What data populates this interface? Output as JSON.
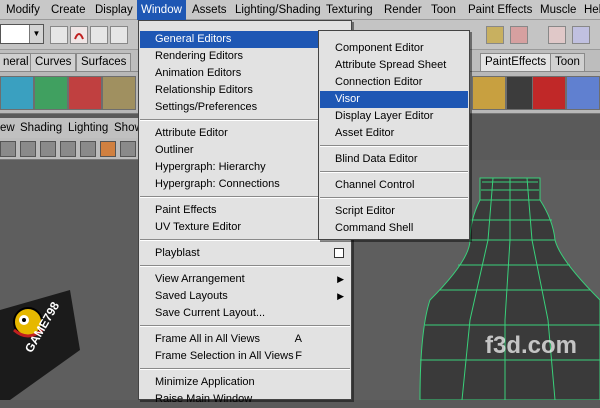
{
  "menubar": {
    "items": [
      "Modify",
      "Create",
      "Display",
      "Window",
      "Assets",
      "Lighting/Shading",
      "Texturing",
      "Render",
      "Toon",
      "Paint Effects",
      "Muscle",
      "Hel"
    ]
  },
  "shelf": {
    "tabs": [
      "neral",
      "Curves",
      "Surfaces",
      "PaintEffects",
      "Toon"
    ]
  },
  "panel": {
    "menus": [
      "ew",
      "Shading",
      "Lighting",
      "Show"
    ]
  },
  "window_menu": {
    "group1": [
      {
        "label": "General Editors",
        "submenu": true
      },
      {
        "label": "Rendering Editors",
        "submenu": true
      },
      {
        "label": "Animation Editors",
        "submenu": true
      },
      {
        "label": "Relationship Editors",
        "submenu": true
      },
      {
        "label": "Settings/Preferences",
        "submenu": true
      }
    ],
    "group2": [
      "Attribute Editor",
      "Outliner",
      "Hypergraph: Hierarchy",
      "Hypergraph: Connections"
    ],
    "group3": [
      "Paint Effects",
      "UV Texture Editor"
    ],
    "group4": [
      "Playblast"
    ],
    "group5": [
      {
        "label": "View Arrangement",
        "submenu": true
      },
      {
        "label": "Saved Layouts",
        "submenu": true
      },
      {
        "label": "Save Current Layout..."
      }
    ],
    "group6": [
      {
        "label": "Frame All in All Views",
        "shortcut": "A"
      },
      {
        "label": "Frame Selection in All Views",
        "shortcut": "F"
      }
    ],
    "group7": [
      "Minimize Application",
      "Raise Main Window"
    ]
  },
  "general_editors_submenu": {
    "group1": [
      "Component Editor",
      "Attribute Spread Sheet",
      "Connection Editor",
      "Visor",
      "Display Layer Editor",
      "Asset Editor"
    ],
    "group2": [
      "Blind Data Editor"
    ],
    "group3": [
      "Channel Control"
    ],
    "group4": [
      "Script Editor",
      "Command Shell"
    ]
  },
  "watermark": {
    "brand": "GAME798",
    "site": "f3d.com"
  },
  "colors": {
    "highlight": "#1e57b4",
    "menu_bg": "#e2e2e2",
    "wire": "#39d07a"
  }
}
